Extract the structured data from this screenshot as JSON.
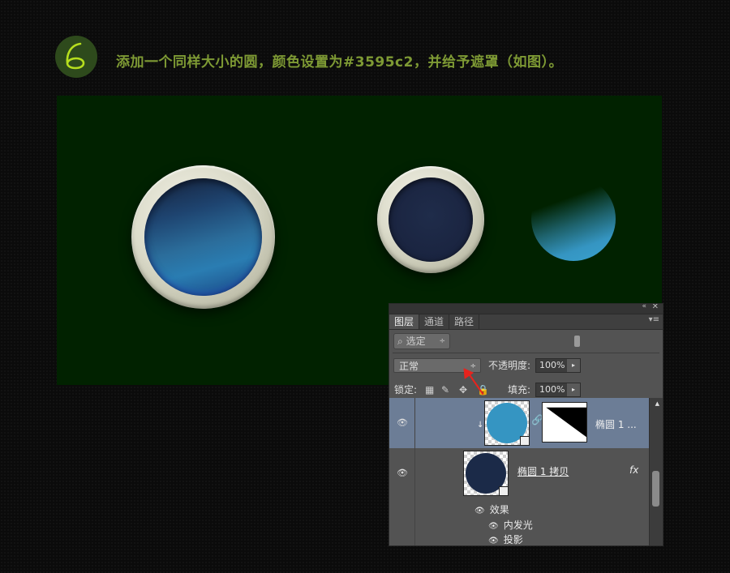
{
  "step": {
    "number": "6"
  },
  "instruction": "添加一个同样大小的圆，颜色设置为#3595c2，并给予遮罩（如图）。",
  "colors": {
    "canvas_bg": "#012200",
    "instruction": "#7e9a34",
    "circle_fill": "#3595c2",
    "layer_selected": "#6c7d96"
  },
  "panel": {
    "topbar": {
      "collapse_icon": "«",
      "close_icon": "✕"
    },
    "tabs": [
      {
        "label": "图层"
      },
      {
        "label": "通道"
      },
      {
        "label": "路径"
      }
    ],
    "menu_icon": "▾≡",
    "filter": {
      "icon": "⌕",
      "label": "选定",
      "arrows": "÷"
    },
    "blend_mode": {
      "value": "正常",
      "arrows": "÷"
    },
    "opacity": {
      "label": "不透明度:",
      "value": "100%",
      "dropdown": "▸"
    },
    "lock": {
      "label": "锁定:",
      "icons": [
        "▦",
        "✎",
        "✥",
        "🔒"
      ]
    },
    "fill": {
      "label": "填充:",
      "value": "100%",
      "dropdown": "▸"
    },
    "layers": [
      {
        "name": "椭圆 1 ...",
        "selected": true,
        "visible_icon": "👁",
        "clip_icon": "↓",
        "chain_icon": "🔗"
      },
      {
        "name": "椭圆 1 拷贝",
        "selected": false,
        "visible_icon": "👁",
        "fx": "fx"
      }
    ],
    "effects": {
      "label": "效果",
      "items": [
        {
          "label": "内发光"
        },
        {
          "label": "投影"
        }
      ]
    }
  }
}
